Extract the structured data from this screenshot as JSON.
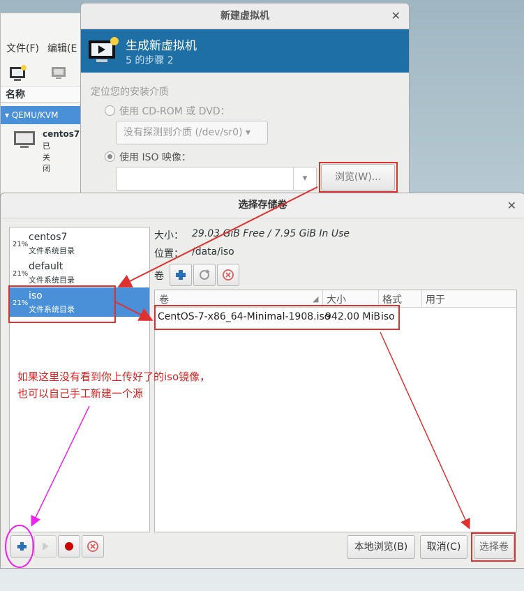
{
  "main_window": {
    "menu": [
      "文件(F)",
      "编辑(E"
    ],
    "column_header": "名称",
    "connection": "QEMU/KVM",
    "vm": {
      "name": "centos7",
      "status": "已关闭"
    }
  },
  "new_vm_dialog": {
    "title": "新建虚拟机",
    "banner_title": "生成新虚拟机",
    "banner_step": "5 的步骤 2",
    "section": "定位您的安装介质",
    "cdrom_option": "使用 CD-ROM 或 DVD：",
    "cdrom_combo": "没有探测到介质 (/dev/sr0)",
    "iso_option": "使用 ISO 映像：",
    "iso_path": "",
    "browse_button": "浏览(W)..."
  },
  "storage_dialog": {
    "title": "选择存储卷",
    "pools": [
      {
        "pct": "21%",
        "name": "centos7",
        "type": "文件系统目录"
      },
      {
        "pct": "21%",
        "name": "default",
        "type": "文件系统目录"
      },
      {
        "pct": "21%",
        "name": "iso",
        "type": "文件系统目录"
      }
    ],
    "size_label": "大小：",
    "size_value": "29.03 GiB Free / 7.95 GiB In Use",
    "location_label": "位置：",
    "location_value": "/data/iso",
    "volumes_label": "卷",
    "columns": [
      "卷",
      "大小",
      "格式",
      "用于"
    ],
    "volume": {
      "name": "CentOS-7-x86_64-Minimal-1908.iso",
      "size": "942.00 MiB",
      "format": "iso",
      "used_by": ""
    },
    "local_browse_button": "本地浏览(B)",
    "cancel_button": "取消(C)",
    "choose_button": "选择卷"
  },
  "annotation": {
    "line1": "如果这里没有看到你上传好了的iso镜像，",
    "line2": "也可以自己手工新建一个源"
  },
  "colors": {
    "accent": "#4a90d9",
    "banner": "#1d6fa6",
    "annotation_red": "#e03030",
    "annotation_magenta": "#ee22ee"
  }
}
